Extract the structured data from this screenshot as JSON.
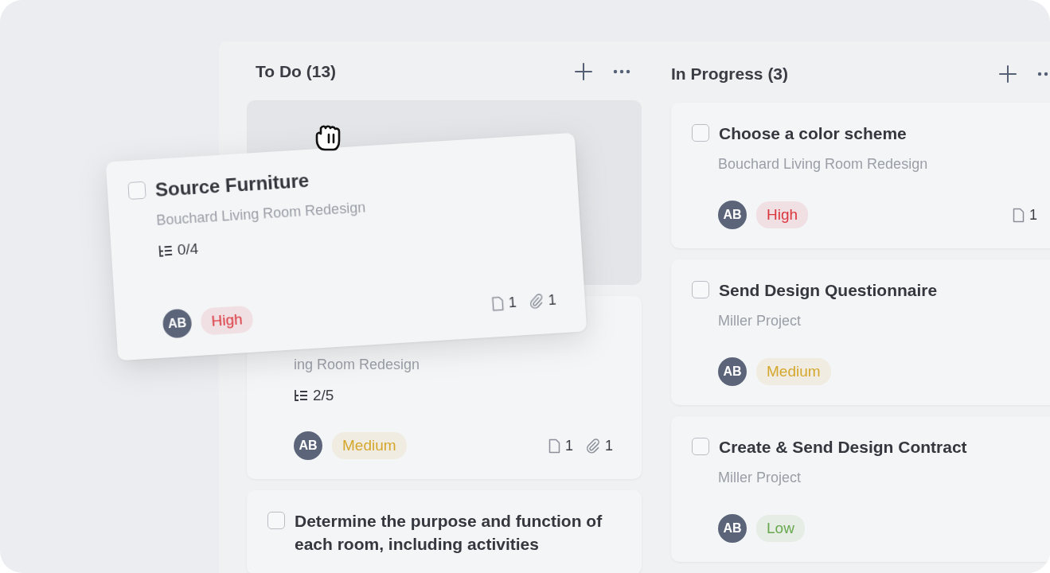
{
  "columns": [
    {
      "title": "To Do (13)",
      "cards": [
        {
          "kind": "drop-slot"
        },
        {
          "kind": "task",
          "subtitle": "ing Room Redesign",
          "subtasks": "2/5",
          "avatar": "AB",
          "tag": {
            "text": "Medium",
            "color": "#d4a72c"
          },
          "files": "1",
          "attachments": "1"
        },
        {
          "kind": "task",
          "title": "Determine the purpose and function of each room, including activities",
          "checked": false
        }
      ]
    },
    {
      "title": "In Progress (3)",
      "cards": [
        {
          "kind": "task",
          "title": "Choose a color scheme",
          "checked": false,
          "subtitle": "Bouchard Living Room Redesign",
          "avatar": "AB",
          "tag": {
            "text": "High",
            "color": "#d9363e"
          },
          "files": "1"
        },
        {
          "kind": "task",
          "title": "Send Design Questionnaire",
          "checked": false,
          "subtitle": "Miller Project",
          "avatar": "AB",
          "tag": {
            "text": "Medium",
            "color": "#d4a72c"
          }
        },
        {
          "kind": "task",
          "title": "Create & Send Design Contract",
          "checked": false,
          "subtitle": "Miller Project",
          "avatar": "AB",
          "tag": {
            "text": "Low",
            "color": "#6aa84f"
          }
        }
      ]
    }
  ],
  "dragged_card": {
    "kind": "task",
    "title": "Source Furniture",
    "checked": false,
    "subtitle": "Bouchard Living Room Redesign",
    "subtasks": "0/4",
    "avatar": "AB",
    "tag": {
      "text": "High",
      "color": "#d9363e"
    },
    "files": "1",
    "attachments": "1"
  }
}
